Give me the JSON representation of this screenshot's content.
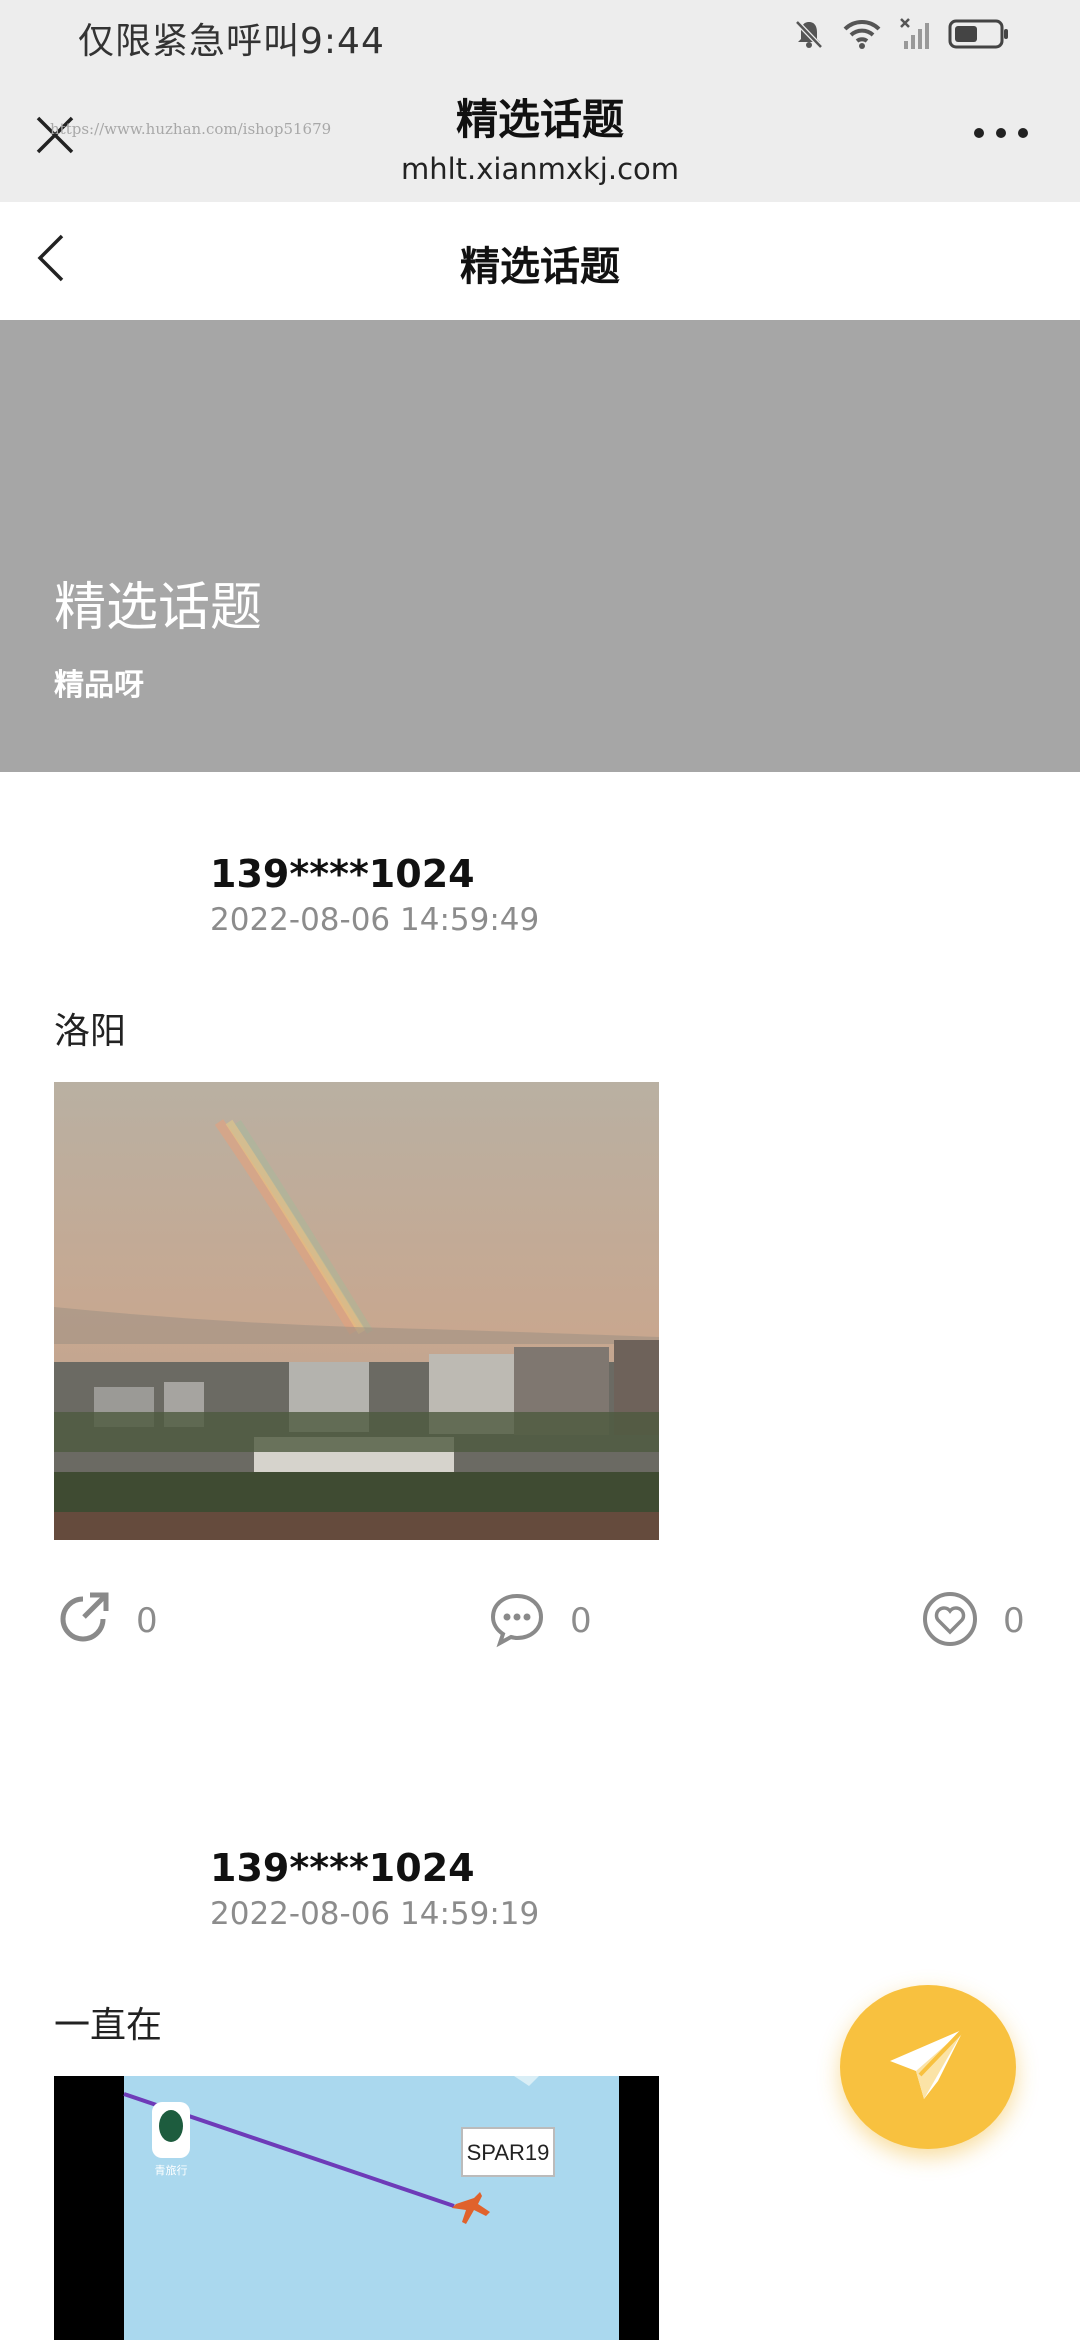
{
  "status_bar": {
    "carrier_text": "仅限紧急呼叫",
    "time": "9:44",
    "icons": [
      "bell-off-icon",
      "wifi-icon",
      "signal-off-icon",
      "battery-icon"
    ]
  },
  "wechat_bar": {
    "title": "精选话题",
    "domain": "mhlt.xianmxkj.com",
    "watermark_url": "https://www.huzhan.com/ishop51679",
    "close_icon": "close-icon",
    "more_icon": "more-icon"
  },
  "page_header": {
    "title": "精选话题",
    "back_icon": "chevron-left-icon"
  },
  "banner": {
    "title": "精选话题",
    "subtitle": "精品呀"
  },
  "posts": [
    {
      "user": "139****1024",
      "time": "2022-08-06 14:59:49",
      "text": "洛阳",
      "image": "rainbow-city-photo",
      "share_count": "0",
      "comment_count": "0",
      "like_count": "0"
    },
    {
      "user": "139****1024",
      "time": "2022-08-06 14:59:19",
      "text": "一直在",
      "image": "flight-map-screenshot",
      "map_label": "SPAR19",
      "map_logo_text": "青旅行"
    }
  ],
  "fab": {
    "icon": "paper-plane-icon",
    "color": "#f8c13f"
  },
  "colors": {
    "status_bg": "#ededed",
    "banner_bg": "#a6a6a6",
    "timestamp": "#8c8c8c",
    "accent": "#f8c13f"
  }
}
